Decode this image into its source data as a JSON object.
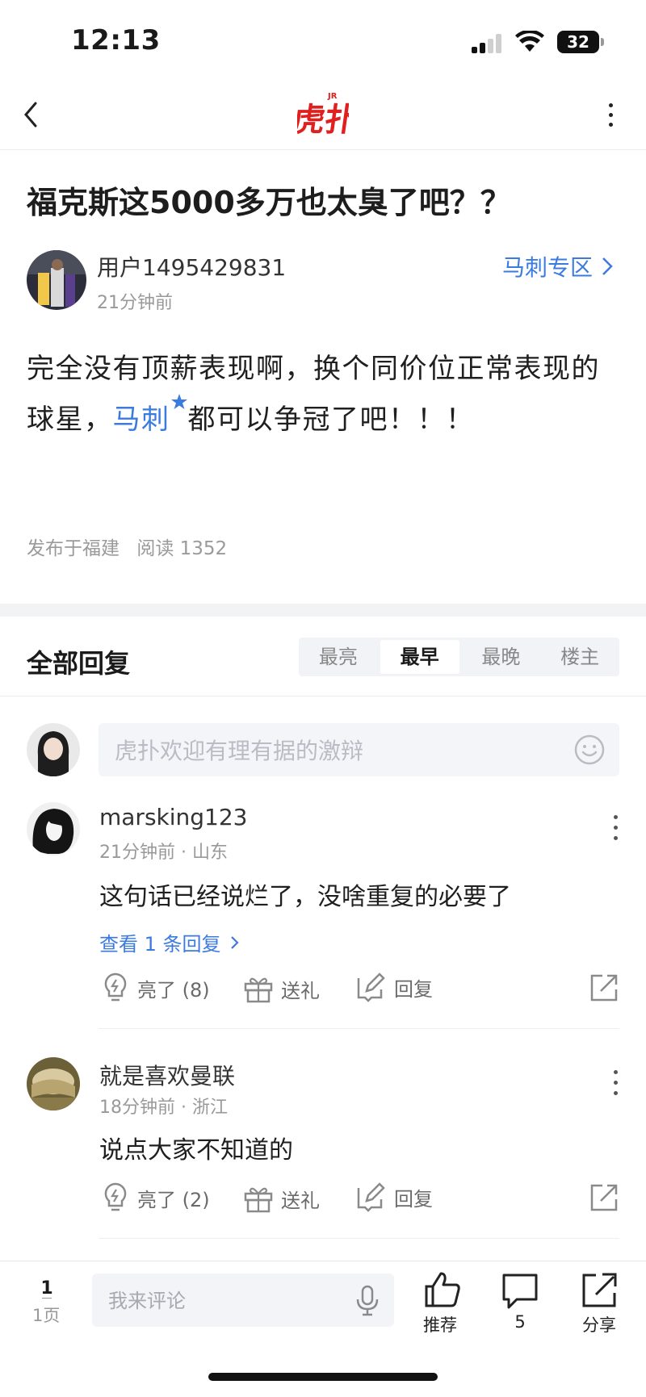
{
  "status_bar": {
    "time": "12:13",
    "battery": "32"
  },
  "nav": {
    "logo_alt": "虎扑"
  },
  "post": {
    "title": "福克斯这5000多万也太臭了吧？？",
    "author": "用户1495429831",
    "time": "21分钟前",
    "zone": "马刺专区",
    "body_before": "完全没有顶薪表现啊，换个同价位正常表现的球星，",
    "body_link": "马刺",
    "body_after": "都可以争冠了吧！！！",
    "location": "发布于福建",
    "reads": "阅读 1352"
  },
  "replies": {
    "title": "全部回复",
    "sort_tabs": [
      "最亮",
      "最早",
      "最晚",
      "楼主"
    ],
    "active_sort": "最早",
    "input_placeholder": "虎扑欢迎有理有据的激辩"
  },
  "comments": [
    {
      "name": "marsking123",
      "time": "21分钟前",
      "location": "山东",
      "text": "这句话已经说烂了，没啥重复的必要了",
      "sub_replies": "查看 1 条回复",
      "like": "亮了 (8)",
      "gift": "送礼",
      "reply": "回复"
    },
    {
      "name": "就是喜欢曼联",
      "time": "18分钟前",
      "location": "浙江",
      "text": "说点大家不知道的",
      "like": "亮了 (2)",
      "gift": "送礼",
      "reply": "回复"
    }
  ],
  "bottom_bar": {
    "page_number": "1",
    "page_label": "1页",
    "comment_placeholder": "我来评论",
    "recommend": "推荐",
    "comment_count": "5",
    "share": "分享"
  },
  "colors": {
    "accent": "#3b7be0",
    "brand": "#e0201f"
  }
}
